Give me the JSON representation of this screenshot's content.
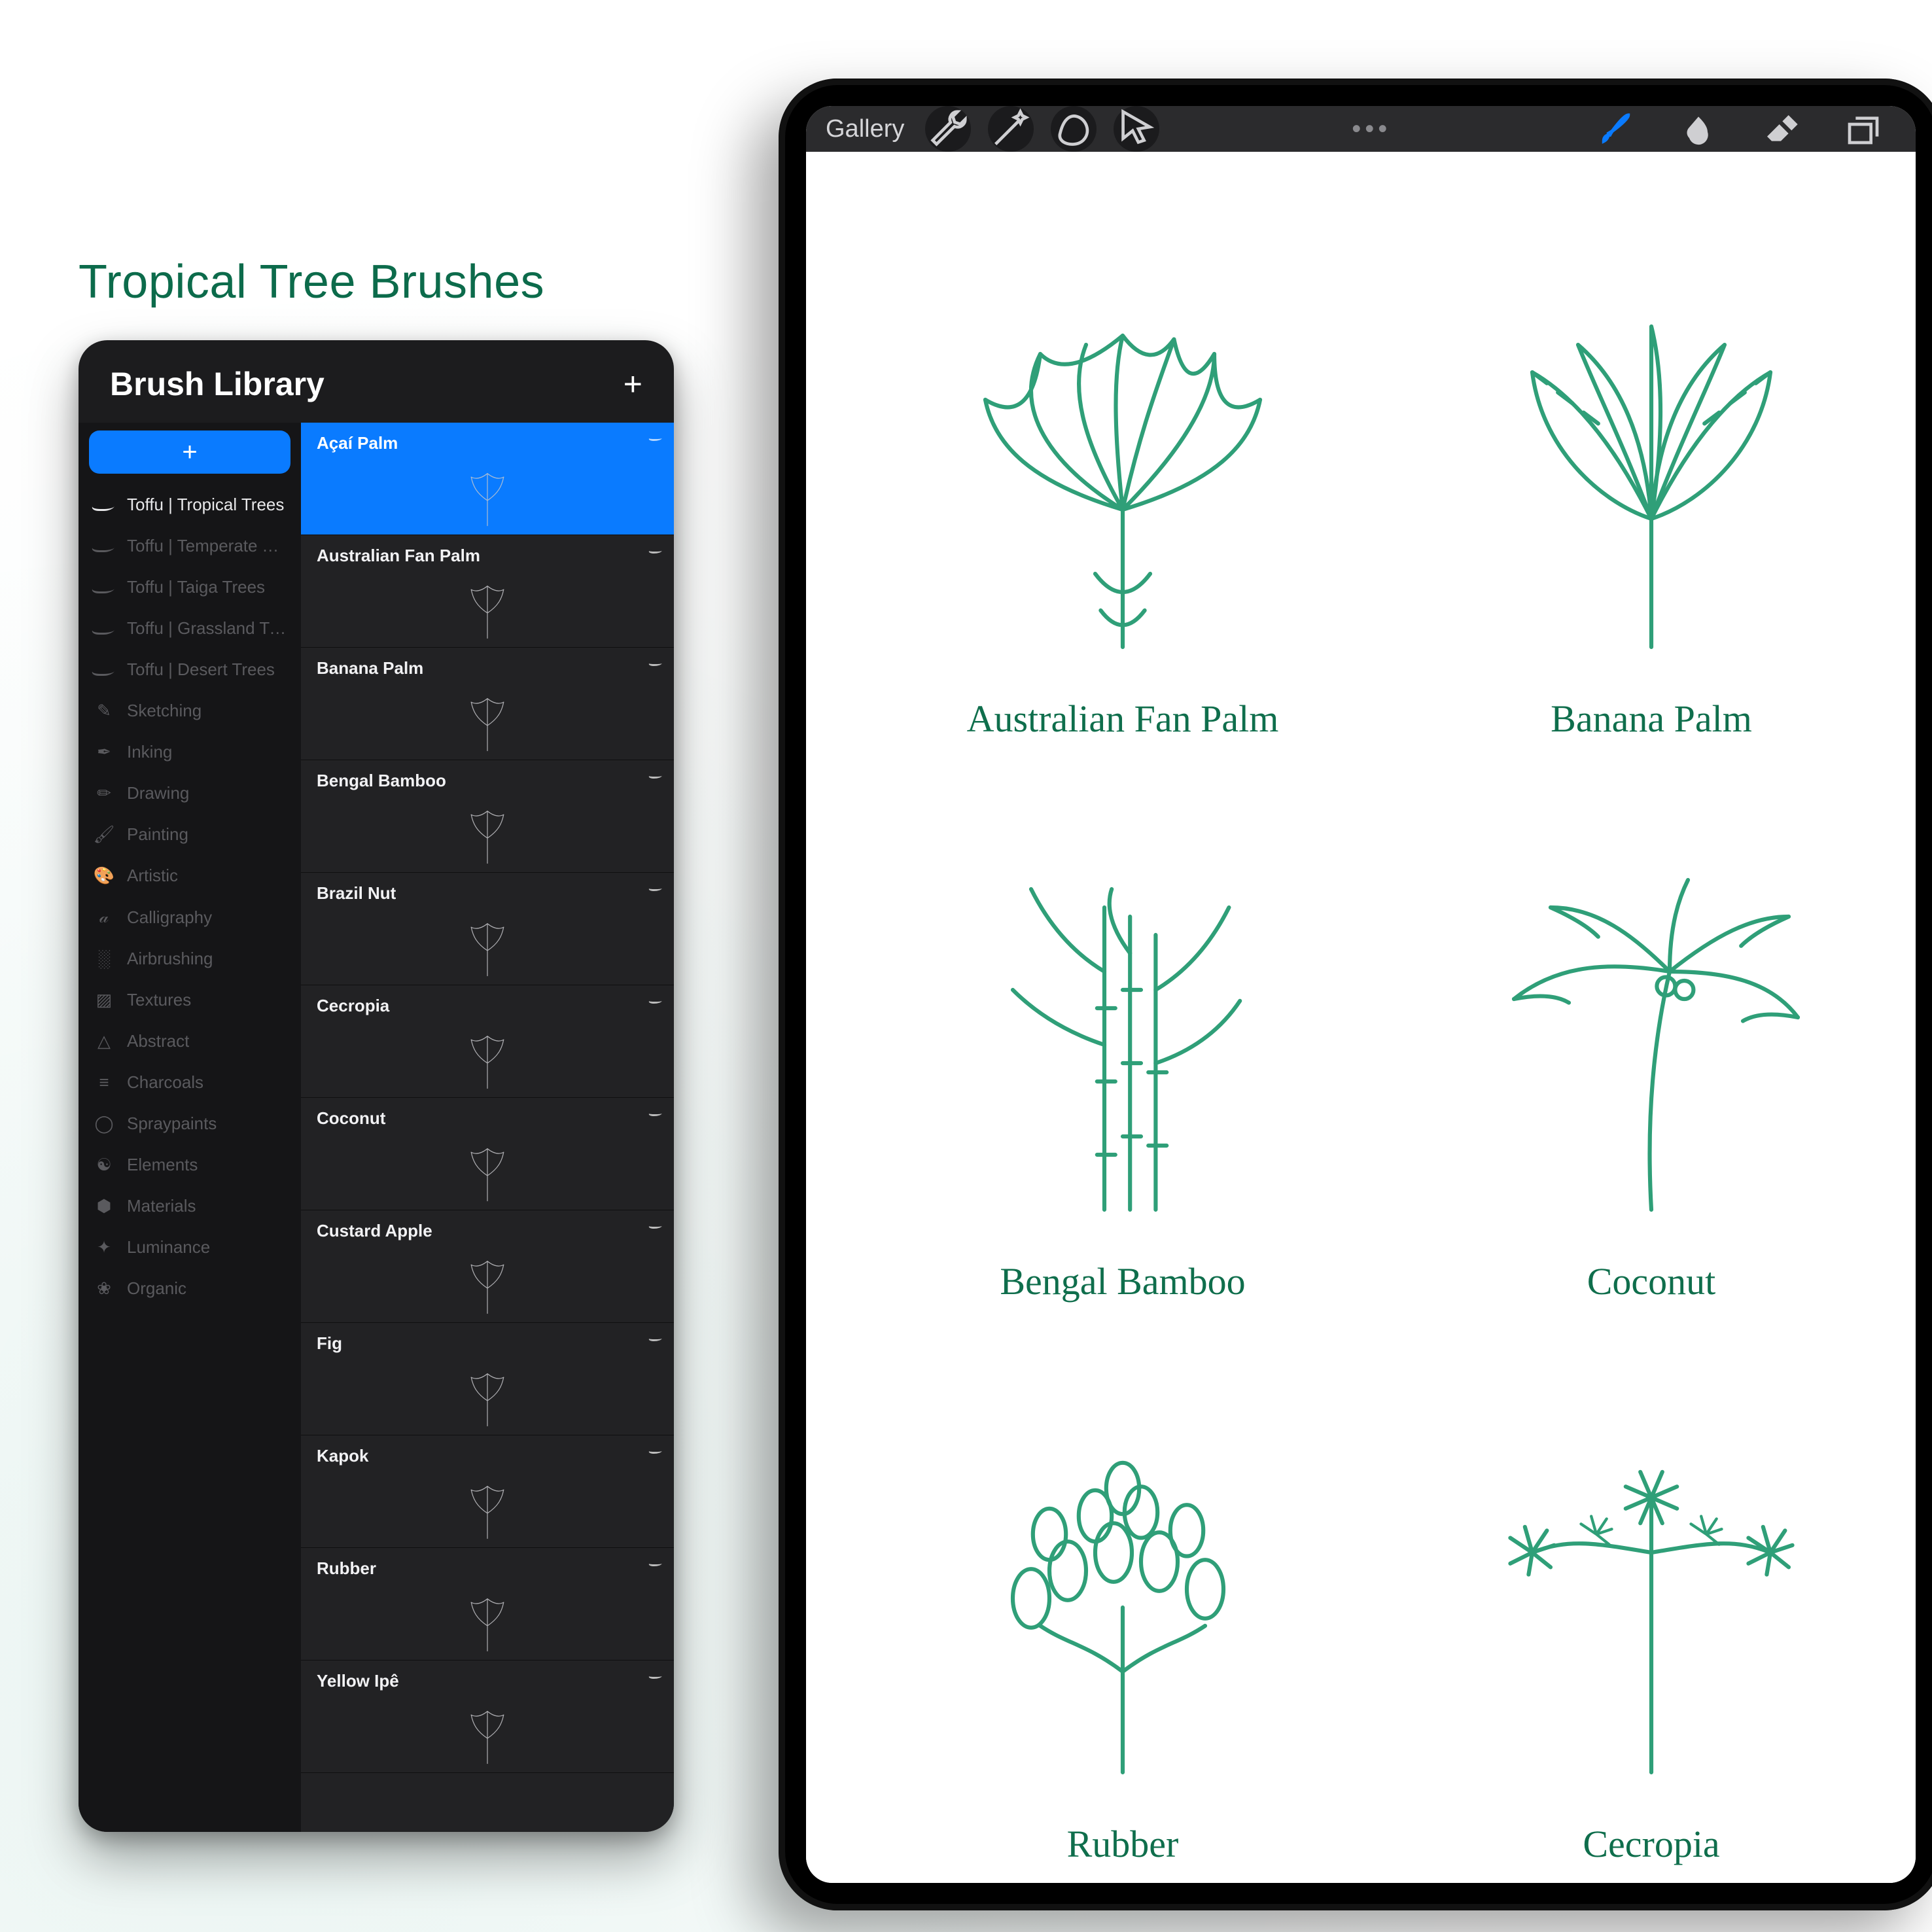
{
  "title": "Tropical Tree Brushes",
  "panel": {
    "header": "Brush Library",
    "categories": [
      {
        "label": "Toffu | Tropical Trees",
        "icon": "swoosh",
        "active": true
      },
      {
        "label": "Toffu | Temperate Tre…",
        "icon": "swoosh",
        "active": false
      },
      {
        "label": "Toffu | Taiga Trees",
        "icon": "swoosh",
        "active": false
      },
      {
        "label": "Toffu | Grassland Trees",
        "icon": "swoosh",
        "active": false
      },
      {
        "label": "Toffu | Desert Trees",
        "icon": "swoosh",
        "active": false
      },
      {
        "label": "Sketching",
        "icon": "✎",
        "active": false
      },
      {
        "label": "Inking",
        "icon": "✒",
        "active": false
      },
      {
        "label": "Drawing",
        "icon": "✏",
        "active": false
      },
      {
        "label": "Painting",
        "icon": "🖌",
        "active": false
      },
      {
        "label": "Artistic",
        "icon": "🎨",
        "active": false
      },
      {
        "label": "Calligraphy",
        "icon": "𝒶",
        "active": false
      },
      {
        "label": "Airbrushing",
        "icon": "░",
        "active": false
      },
      {
        "label": "Textures",
        "icon": "▨",
        "active": false
      },
      {
        "label": "Abstract",
        "icon": "△",
        "active": false
      },
      {
        "label": "Charcoals",
        "icon": "≡",
        "active": false
      },
      {
        "label": "Spraypaints",
        "icon": "◯",
        "active": false
      },
      {
        "label": "Elements",
        "icon": "☯",
        "active": false
      },
      {
        "label": "Materials",
        "icon": "⬢",
        "active": false
      },
      {
        "label": "Luminance",
        "icon": "✦",
        "active": false
      },
      {
        "label": "Organic",
        "icon": "❀",
        "active": false
      }
    ],
    "brushes": [
      {
        "name": "Açaí Palm",
        "selected": true
      },
      {
        "name": "Australian Fan Palm",
        "selected": false
      },
      {
        "name": "Banana Palm",
        "selected": false
      },
      {
        "name": "Bengal Bamboo",
        "selected": false
      },
      {
        "name": "Brazil Nut",
        "selected": false
      },
      {
        "name": "Cecropia",
        "selected": false
      },
      {
        "name": "Coconut",
        "selected": false
      },
      {
        "name": "Custard Apple",
        "selected": false
      },
      {
        "name": "Fig",
        "selected": false
      },
      {
        "name": "Kapok",
        "selected": false
      },
      {
        "name": "Rubber",
        "selected": false
      },
      {
        "name": "Yellow Ipê",
        "selected": false
      }
    ]
  },
  "ipad": {
    "gallery_label": "Gallery",
    "toolbar_icons": [
      "wrench",
      "wand",
      "shape",
      "cursor"
    ],
    "canvas_plants": [
      {
        "caption": "Australian Fan Palm",
        "shape": "fanpalm"
      },
      {
        "caption": "Banana Palm",
        "shape": "banana"
      },
      {
        "caption": "Bengal Bamboo",
        "shape": "bamboo"
      },
      {
        "caption": "Coconut",
        "shape": "coconut"
      },
      {
        "caption": "Rubber",
        "shape": "rubber"
      },
      {
        "caption": "Cecropia",
        "shape": "cecropia"
      }
    ]
  },
  "colors": {
    "accent_green": "#0f6e4c",
    "accent_blue": "#0a7bff",
    "panel_bg": "#1c1c1e"
  }
}
